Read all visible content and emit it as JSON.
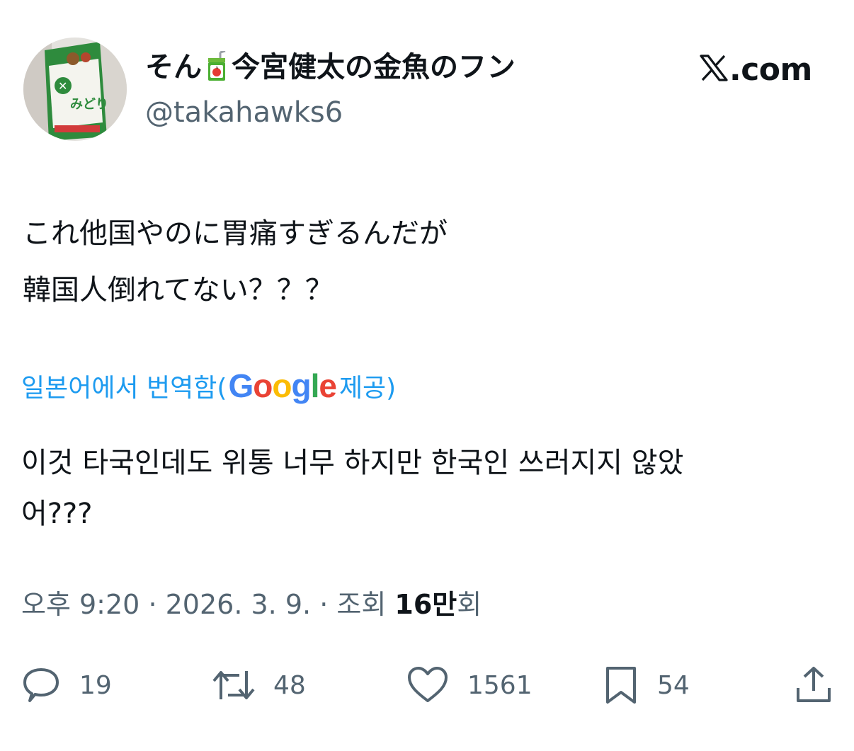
{
  "app": {
    "brand": "X.com"
  },
  "author": {
    "name_part1": "そん",
    "name_part2": "今宮健太の金魚のフン",
    "emoji": "juice-box-icon",
    "handle": "@takahawks6",
    "avatar_text": "みどり"
  },
  "tweet": {
    "lines": [
      "これ他国やのに胃痛すぎるんだが",
      "韓国人倒れてない？？？"
    ]
  },
  "translation": {
    "label": "일본어에서 번역함(",
    "google": [
      "G",
      "o",
      "o",
      "g",
      "l",
      "e"
    ],
    "suffix": " 제공)",
    "lines": [
      "이것 타국인데도 위통 너무 하지만 한국인 쓰러지지 않았",
      "어???"
    ]
  },
  "meta": {
    "time": "오후 9:20",
    "separator": "·",
    "date": "2026. 3. 9.",
    "views_label": "조회",
    "views_count": "16만",
    "views_suffix": "회"
  },
  "actions": {
    "reply_count": "19",
    "repost_count": "48",
    "like_count": "1561",
    "bookmark_count": "54"
  },
  "colors": {
    "text": "#0f1419",
    "secondary": "#536471",
    "link": "#1d9bf0",
    "google_blue": "#4285f4",
    "google_red": "#ea4335",
    "google_yellow": "#fbbc05",
    "google_green": "#34a853"
  }
}
